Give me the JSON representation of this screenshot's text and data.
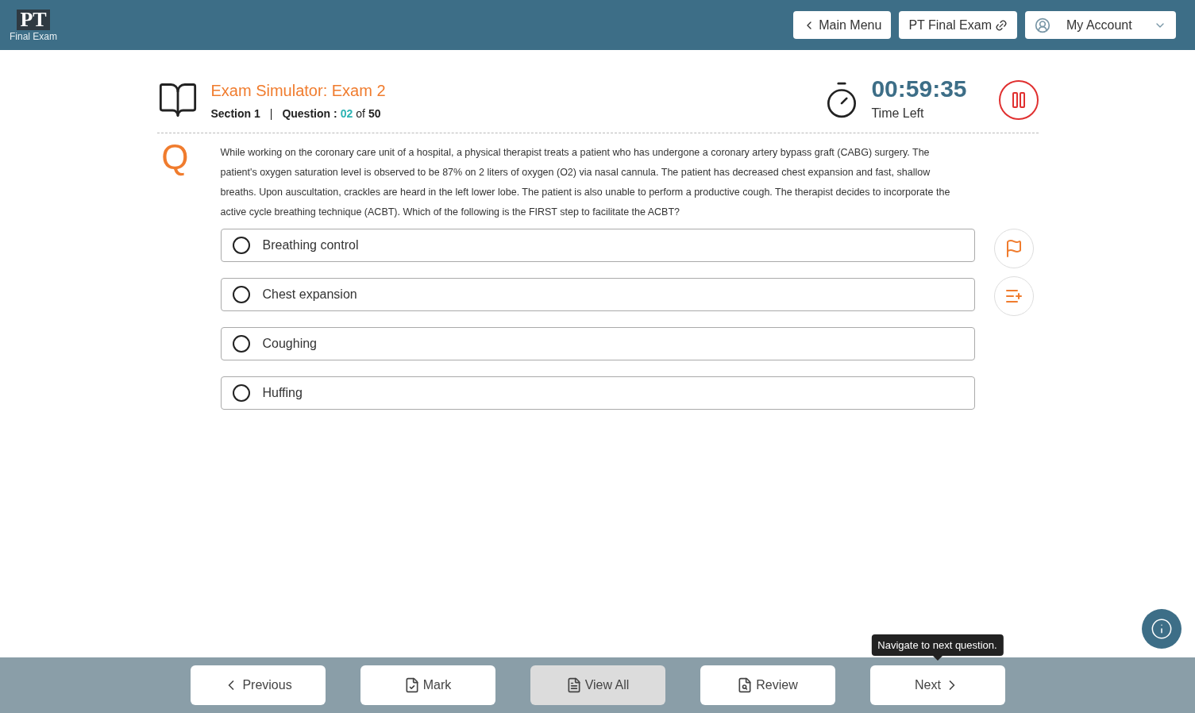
{
  "logo": {
    "letters": "PT",
    "caption": "Final Exam"
  },
  "header_buttons": [
    {
      "kind": "back",
      "label": "Main Menu"
    },
    {
      "kind": "link",
      "label": "PT Final Exam"
    },
    {
      "kind": "account",
      "label": "My Account"
    }
  ],
  "exam": {
    "title": "Exam Simulator: Exam 2",
    "section": "Section 1",
    "separator": "|",
    "question_label": "Question :",
    "question_number": "02",
    "of": "of",
    "total": "50"
  },
  "timer": {
    "time": "00:59:35",
    "caption": "Time Left"
  },
  "question": {
    "marker": "Q",
    "text": "While working on the coronary care unit of a hospital, a physical therapist treats a patient who has undergone a coronary artery bypass graft (CABG) surgery. The patient's oxygen saturation level is observed to be 87% on 2 liters of oxygen (O2) via nasal cannula. The patient has decreased chest expansion and fast, shallow breaths. Upon auscultation, crackles are heard in the left lower lobe. The patient is also unable to perform a productive cough. The therapist decides to incorporate the active cycle breathing technique (ACBT). Which of the following is the FIRST step to facilitate the ACBT?"
  },
  "options": [
    {
      "label": "Breathing control",
      "selected": false
    },
    {
      "label": "Chest expansion",
      "selected": false
    },
    {
      "label": "Coughing",
      "selected": false
    },
    {
      "label": "Huffing",
      "selected": false
    }
  ],
  "side_actions": [
    {
      "kind": "flag"
    },
    {
      "kind": "add-note"
    }
  ],
  "tooltip": "Navigate to next question.",
  "footer_buttons": [
    {
      "kind": "previous",
      "label": "Previous",
      "selected": false
    },
    {
      "kind": "mark",
      "label": "Mark",
      "selected": false
    },
    {
      "kind": "view",
      "label": "View All",
      "selected": true
    },
    {
      "kind": "review",
      "label": "Review",
      "selected": false
    },
    {
      "kind": "next",
      "label": "Next",
      "selected": false
    }
  ]
}
